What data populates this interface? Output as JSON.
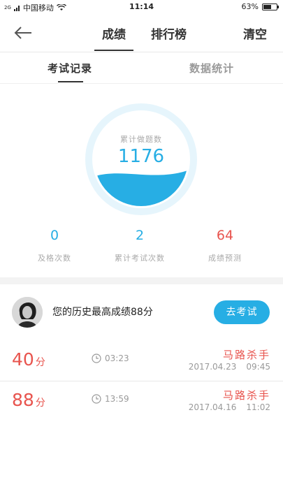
{
  "status_bar": {
    "carrier": "中国移动",
    "network": "2G",
    "time": "11:14",
    "battery": "63%",
    "battery_level": 0.63
  },
  "nav": {
    "back_icon": "arrow-left-icon",
    "tabs": [
      {
        "label": "成绩",
        "active": true
      },
      {
        "label": "排行榜",
        "active": false
      }
    ],
    "clear_label": "清空"
  },
  "sub_tabs": [
    {
      "label": "考试记录",
      "active": true
    },
    {
      "label": "数据统计",
      "active": false
    }
  ],
  "gauge": {
    "label": "累计做题数",
    "value": "1176",
    "fill_level": 0.35
  },
  "stats": [
    {
      "value": "0",
      "label": "及格次数",
      "color": "#27aee4"
    },
    {
      "value": "2",
      "label": "累计考试次数",
      "color": "#27aee4"
    },
    {
      "value": "64",
      "label": "成绩预测",
      "color": "#e8544e"
    }
  ],
  "history": {
    "best_text": "您的历史最高成绩88分",
    "exam_button": "去考试",
    "records": [
      {
        "score": "40",
        "unit": "分",
        "duration": "03:23",
        "title": "马路杀手",
        "date": "2017.04.23",
        "time": "09:45"
      },
      {
        "score": "88",
        "unit": "分",
        "duration": "13:59",
        "title": "马路杀手",
        "date": "2017.04.16",
        "time": "11:02"
      }
    ]
  },
  "colors": {
    "accent": "#27aee4",
    "score_red": "#e8544e",
    "ring": "#e6f5fc"
  }
}
